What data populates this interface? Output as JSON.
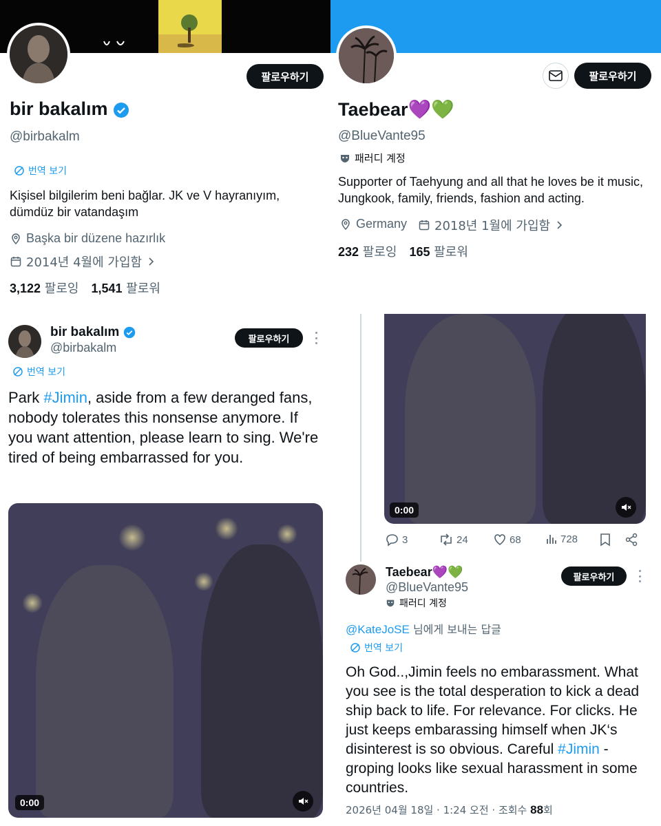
{
  "left_profile": {
    "name": "bir bakalım",
    "handle": "@birbakalm",
    "follow_label": "팔로우하기",
    "translate_label": "번역 보기",
    "bio": "Kişisel bilgilerim beni bağlar. JK ve V hayranıyım, dümdüz bir vatandaşım",
    "location": "Başka bir düzene hazırlık",
    "joined": "2014년 4월에 가입함",
    "following_count": "3,122",
    "following_label": "팔로잉",
    "followers_count": "1,541",
    "followers_label": "팔로워"
  },
  "right_profile": {
    "name": "Taebear💜💚",
    "handle": "@BlueVante95",
    "follow_label": "팔로우하기",
    "parody_label": "패러디 계정",
    "bio": "Supporter of Taehyung and all that he loves be it music, Jungkook, family, friends, fashion and acting.",
    "location": "Germany",
    "joined": "2018년 1월에 가입함",
    "following_count": "232",
    "following_label": "팔로잉",
    "followers_count": "165",
    "followers_label": "팔로워"
  },
  "left_tweet": {
    "name": "bir bakalım",
    "handle": "@birbakalm",
    "follow_label": "팔로우하기",
    "translate_label": "번역 보기",
    "text_prefix": "Park ",
    "hashtag": "#Jimin",
    "text_suffix": ", aside from a few deranged fans, nobody tolerates this nonsense anymore. If you want attention, please learn to sing. We're tired of being embarrassed for you.",
    "video_time": "0:00"
  },
  "right_tweet_media": {
    "video_time": "0:00",
    "replies": "3",
    "retweets": "24",
    "likes": "68",
    "views": "728"
  },
  "right_reply": {
    "name": "Taebear💜💚",
    "handle": "@BlueVante95",
    "follow_label": "팔로우하기",
    "parody_label": "패러디 계정",
    "reply_to_user": "@KateJoSE",
    "reply_to_suffix": " 님에게 보내는 답글",
    "translate_label": "번역 보기",
    "text_main": "Oh God..,Jimin feels no embarassment. What you see is the total desperation to kick a dead ship back to life. For relevance. For clicks. He just keeps embarassing himself when JK‘s disinterest is so obvious. Careful ",
    "hashtag": "#Jimin",
    "text_end": " - groping looks like sexual harassment in some countries.",
    "timestamp": "2026년 04월 18일 · 1:24 오전 · 조회수 ",
    "views": "88",
    "views_suffix": "회"
  },
  "colors": {
    "accent": "#1d9bf0",
    "text": "#0f1419",
    "muted": "#536471",
    "button": "#0f1419"
  }
}
